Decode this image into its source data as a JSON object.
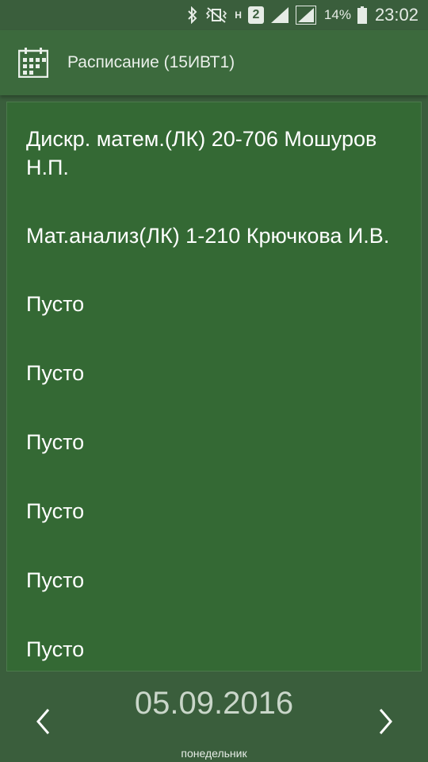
{
  "status_bar": {
    "network_badge": "2",
    "h_indicator": "H",
    "battery_percent": "14%",
    "time": "23:02"
  },
  "app_bar": {
    "icon": "calendar-icon",
    "title": "Расписание (15ИВТ1)"
  },
  "schedule": {
    "items": [
      "Дискр. матем.(ЛК) 20-706 Мошуров Н.П.",
      "Мат.анализ(ЛК) 1-210 Крючкова И.В.",
      "Пусто",
      "Пусто",
      "Пусто",
      "Пусто",
      "Пусто",
      "Пусто"
    ]
  },
  "footer": {
    "date": "05.09.2016",
    "weekday": "понедельник",
    "prev_icon": "chevron-left-icon",
    "next_icon": "chevron-right-icon"
  },
  "colors": {
    "background": "#3a5e3c",
    "app_bar": "#3c6a3d",
    "list_panel": "#346934",
    "date_text": "#c9d6c9"
  }
}
